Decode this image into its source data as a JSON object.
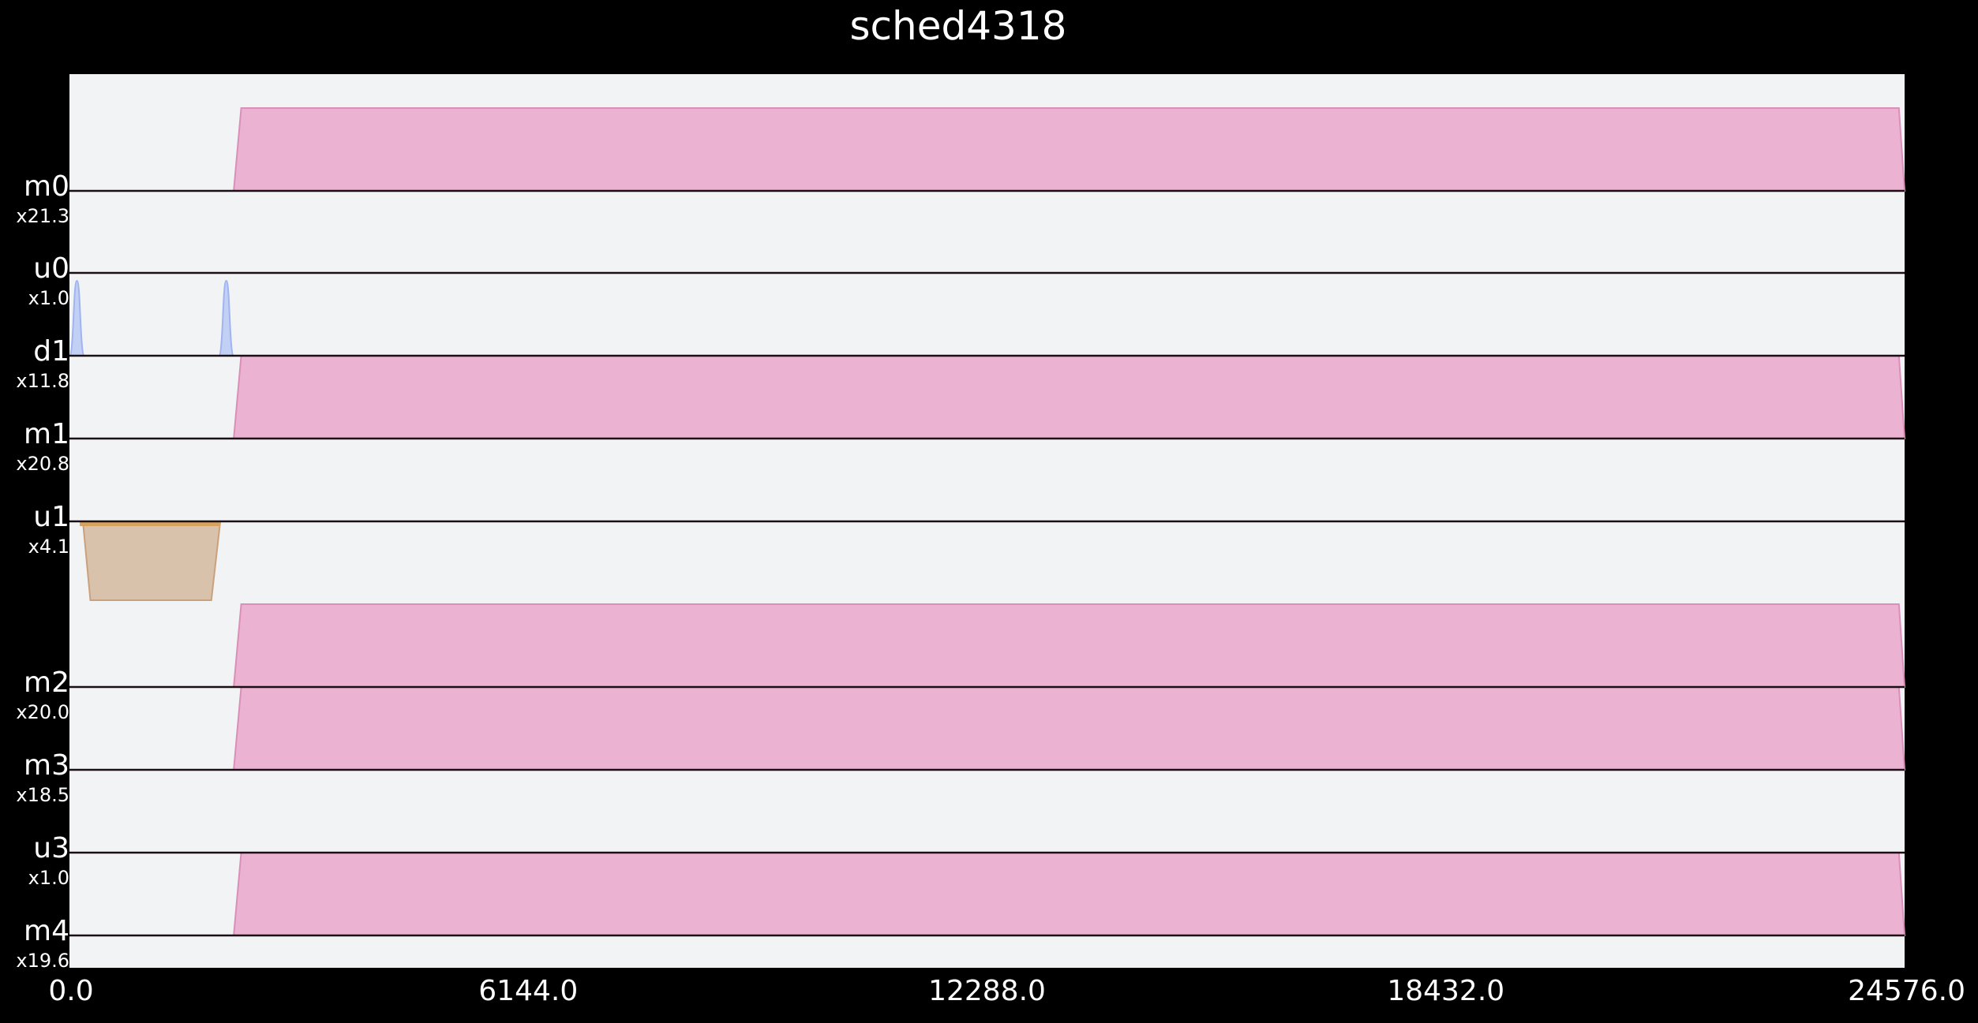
{
  "chart_data": {
    "type": "area",
    "title": "sched4318",
    "xlim": [
      0,
      24576
    ],
    "x_ticks": [
      0,
      6144,
      12288,
      18432,
      24576
    ],
    "x_tick_labels": [
      "0.0",
      "6144.0",
      "12288.0",
      "18432.0",
      "24576.0"
    ],
    "grid": false,
    "legend": "none",
    "colors": {
      "background": "#000000",
      "plot_background": "#f2f3f5",
      "m": "#ebb3d1",
      "m_edge": "#d98fb8",
      "u": "#d9c2ab",
      "u_edge": "#c9a17c",
      "u_bar": "#d6a35e",
      "d": "#c3d0f6",
      "d_edge": "#9fb4f0",
      "baseline": "#1a0f14",
      "text": "#ffffff"
    },
    "lanes": [
      {
        "name": "m0",
        "scale": "x21.3",
        "kind": "m"
      },
      {
        "name": "u0",
        "scale": "x1.0",
        "kind": "u"
      },
      {
        "name": "d1",
        "scale": "x11.8",
        "kind": "d"
      },
      {
        "name": "m1",
        "scale": "x20.8",
        "kind": "m"
      },
      {
        "name": "u1",
        "scale": "x4.1",
        "kind": "u"
      },
      {
        "name": "m2",
        "scale": "x20.0",
        "kind": "m"
      },
      {
        "name": "m3",
        "scale": "x18.5",
        "kind": "m"
      },
      {
        "name": "u3",
        "scale": "x1.0",
        "kind": "u"
      },
      {
        "name": "m4",
        "scale": "x19.6",
        "kind": "m"
      }
    ],
    "series": [
      {
        "lane": "m0",
        "shape": "trapezoid-up",
        "x_start": 2200,
        "x_plateau_start": 2300,
        "x_plateau_end": 24500,
        "x_end": 24576
      },
      {
        "lane": "d1",
        "shape": "spike-up",
        "x_center": 100,
        "x_width": 200
      },
      {
        "lane": "d1",
        "shape": "spike-up",
        "x_center": 2100,
        "x_width": 200
      },
      {
        "lane": "m1",
        "shape": "trapezoid-up",
        "x_start": 2200,
        "x_plateau_start": 2300,
        "x_plateau_end": 24500,
        "x_end": 24576
      },
      {
        "lane": "u1",
        "shape": "trapezoid-down",
        "x_start": 180,
        "x_plateau_start": 280,
        "x_plateau_end": 1900,
        "x_end": 2020
      },
      {
        "lane": "m2",
        "shape": "trapezoid-up",
        "x_start": 2200,
        "x_plateau_start": 2300,
        "x_plateau_end": 24500,
        "x_end": 24576
      },
      {
        "lane": "m3",
        "shape": "trapezoid-up",
        "x_start": 2200,
        "x_plateau_start": 2300,
        "x_plateau_end": 24500,
        "x_end": 24576
      },
      {
        "lane": "m4",
        "shape": "trapezoid-up",
        "x_start": 2200,
        "x_plateau_start": 2300,
        "x_plateau_end": 24500,
        "x_end": 24576
      }
    ]
  }
}
